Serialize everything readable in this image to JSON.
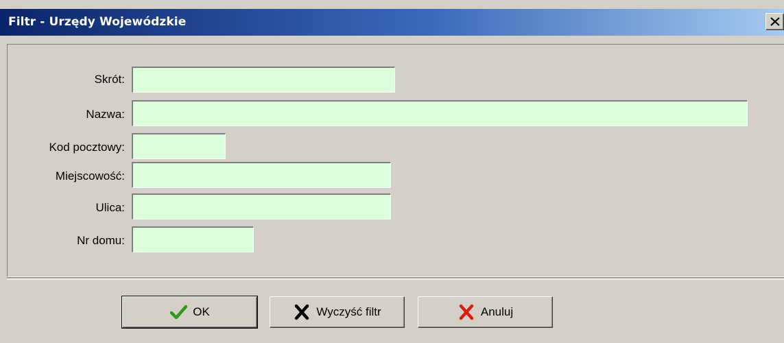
{
  "window": {
    "title": "Filtr - Urzędy Wojewódzkie",
    "close_icon": "close-icon"
  },
  "form": {
    "fields": [
      {
        "key": "skrot",
        "label": "Skrót:",
        "value": ""
      },
      {
        "key": "nazwa",
        "label": "Nazwa:",
        "value": ""
      },
      {
        "key": "kod_pocztowy",
        "label": "Kod pocztowy:",
        "value": ""
      },
      {
        "key": "miejscowosc",
        "label": "Miejscowość:",
        "value": ""
      },
      {
        "key": "ulica",
        "label": "Ulica:",
        "value": ""
      },
      {
        "key": "nr_domu",
        "label": "Nr domu:",
        "value": ""
      }
    ],
    "field_background": "#dcffdc"
  },
  "buttons": {
    "ok_label": "OK",
    "ok_icon": "checkmark-icon",
    "clear_label": "Wyczyść filtr",
    "clear_icon": "x-icon",
    "cancel_label": "Anuluj",
    "cancel_icon": "red-x-icon"
  },
  "colors": {
    "titlebar_start": "#0a246a",
    "titlebar_end": "#a6caf0",
    "ok_check": "#2e9a1c",
    "cancel_x": "#d81e10"
  }
}
